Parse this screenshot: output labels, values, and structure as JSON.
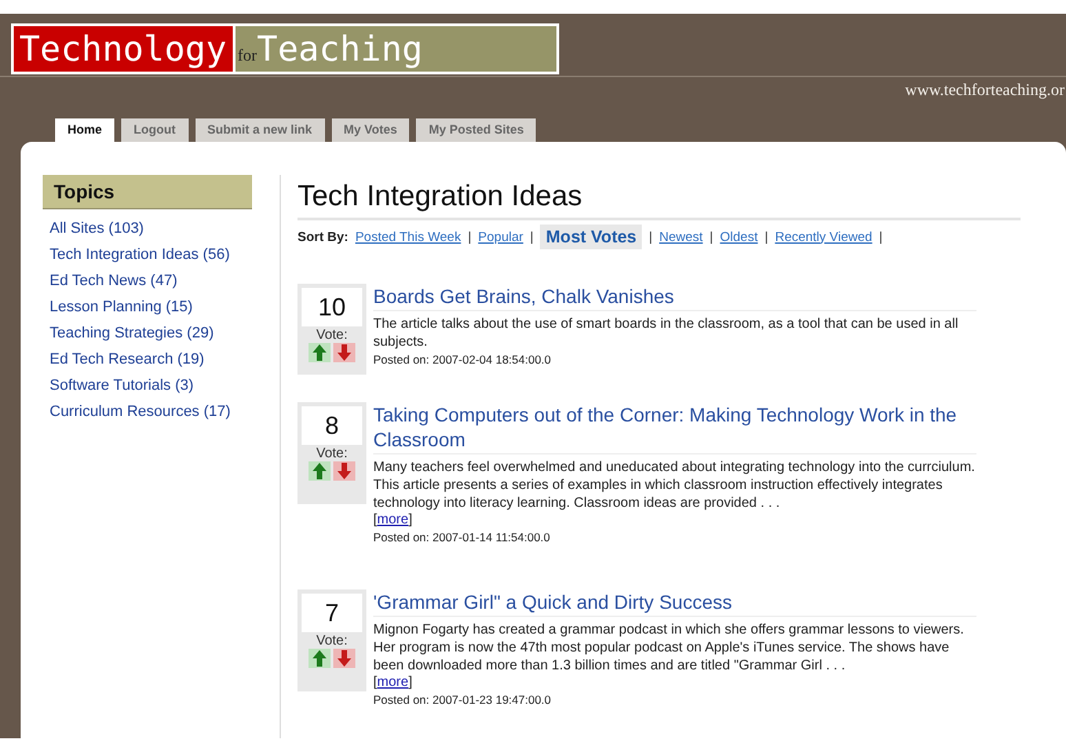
{
  "header": {
    "logo": {
      "first": "Technology",
      "small": "for",
      "second": "Teaching"
    },
    "url": "www.techforteaching.or"
  },
  "tabs": [
    {
      "label": "Home",
      "selected": true
    },
    {
      "label": "Logout",
      "selected": false
    },
    {
      "label": "Submit a new link",
      "selected": false
    },
    {
      "label": "My Votes",
      "selected": false
    },
    {
      "label": "My Posted Sites",
      "selected": false
    }
  ],
  "sidebar": {
    "title": "Topics",
    "items": [
      "All Sites (103)",
      "Tech Integration Ideas (56)",
      "Ed Tech News (47)",
      "Lesson Planning (15)",
      "Teaching Strategies (29)",
      "Ed Tech Research (19)",
      "Software Tutorials (3)",
      "Curriculum Resources (17)"
    ]
  },
  "main": {
    "title": "Tech Integration Ideas",
    "sort_label": "Sort By:",
    "sort_options": [
      {
        "label": "Posted This Week",
        "selected": false,
        "separator": "|"
      },
      {
        "label": "Popular",
        "selected": false,
        "separator": "|"
      },
      {
        "label": "Most Votes",
        "selected": true,
        "separator": "|"
      },
      {
        "label": "Newest",
        "selected": false,
        "separator": "|"
      },
      {
        "label": "Oldest",
        "selected": false,
        "separator": "|"
      },
      {
        "label": "Recently Viewed",
        "selected": false,
        "separator": "|"
      }
    ],
    "posts": [
      {
        "votes": "10",
        "vote_label": "Vote:",
        "title": "Boards Get Brains, Chalk Vanishes",
        "summary": "The article talks about the use of smart boards in the classroom, as a tool that can be used in all subjects.",
        "posted": "Posted on: 2007-02-04 18:54:00.0"
      },
      {
        "votes": "8",
        "vote_label": "Vote:",
        "title": "Taking Computers out of the Corner: Making Technology Work in the Classroom",
        "summary": "Many teachers feel overwhelmed and uneducated about integrating technology into the currciulum. This article presents a series of examples in which classroom instruction effectively integrates technology into literacy learning. Classroom ideas are provided . . .",
        "more": {
          "open": "[",
          "link": "more",
          "close": "]"
        },
        "posted": "Posted on: 2007-01-14 11:54:00.0"
      },
      {
        "votes": "7",
        "vote_label": "Vote:",
        "title": "'Grammar Girl\" a Quick and Dirty Success",
        "summary": "Mignon Fogarty has created a grammar podcast in which she offers grammar lessons to viewers. Her program is now the 47th most popular podcast on Apple's iTunes service. The shows have been downloaded more than 1.3 billion times and are titled \"Grammar Girl . . .",
        "more": {
          "open": "[",
          "link": "more",
          "close": "]"
        },
        "posted": "Posted on: 2007-01-23 19:47:00.0"
      }
    ]
  }
}
